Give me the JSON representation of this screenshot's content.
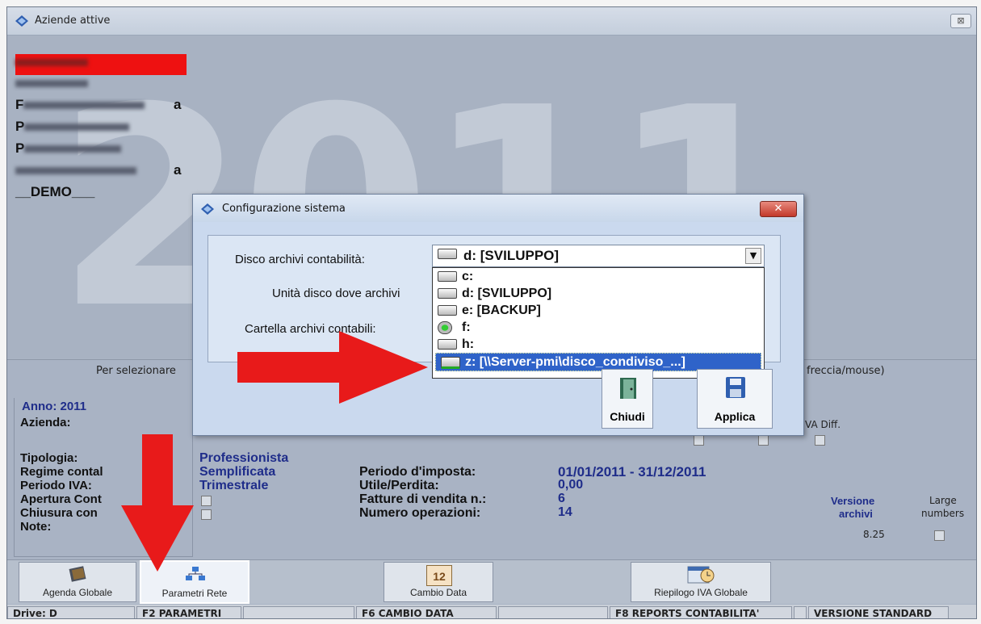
{
  "window": {
    "title": "Aziende attive",
    "close_glyph": "⊠"
  },
  "background_year": "2011",
  "companies": {
    "items": [
      {
        "label": "",
        "suffix": "",
        "blur_w": 90,
        "selected": true
      },
      {
        "label": "",
        "suffix": "",
        "blur_w": 90,
        "selected": false
      },
      {
        "label": "F",
        "suffix": "a",
        "blur_w": 150,
        "selected": false
      },
      {
        "label": "P",
        "suffix": "",
        "blur_w": 130,
        "selected": false
      },
      {
        "label": "P",
        "suffix": "",
        "blur_w": 120,
        "selected": false
      },
      {
        "label": "",
        "suffix": "a",
        "blur_w": 150,
        "selected": false
      },
      {
        "label": "__DEMO___",
        "suffix": "",
        "blur_w": 0,
        "selected": false
      }
    ]
  },
  "hint": {
    "left": "Per selezionare",
    "right": "freccia/mouse)"
  },
  "info": {
    "year_label": "Anno: 2011",
    "azienda_label": "Azienda:",
    "tipologia_label": "Tipologia:",
    "regime_label": "Regime contal",
    "periodo_iva_label": "Periodo IVA:",
    "apertura_label": "Apertura Cont",
    "chiusura_label": "Chiusura con",
    "note_label": "Note:",
    "tipologia_value": "Professionista",
    "regime_value": "Semplificata",
    "periodo_iva_value": "Trimestrale",
    "periodo_imposta_label": "Periodo d'imposta:",
    "utile_label": "Utile/Perdita:",
    "fatture_label": "Fatture di vendita n.:",
    "operazioni_label": "Numero operazioni:",
    "periodo_imposta_value": "01/01/2011 - 31/12/2011",
    "utile_value": "0,00",
    "fatture_value": "6",
    "operazioni_value": "14",
    "iva_diff_label": "VA Diff.",
    "versione_label_1": "Versione",
    "versione_label_2": "archivi",
    "versione_value": "8.25",
    "large_label_1": "Large",
    "large_label_2": "numbers"
  },
  "toolbar": {
    "agenda": "Agenda Globale",
    "parametri": "Parametri Rete",
    "cambio": "Cambio Data",
    "calendar_day": "12",
    "riepilogo": "Riepilogo IVA Globale"
  },
  "statusbar": {
    "drive": "Drive: D",
    "f2": "F2 PARAMETRI",
    "f6": "F6 CAMBIO DATA",
    "f8": "F8 REPORTS CONTABILITA'",
    "versione": "VERSIONE STANDARD"
  },
  "dialog": {
    "title": "Configurazione sistema",
    "close_glyph": "✕",
    "disco_label": "Disco archivi contabilità:",
    "unita_label": "Unità disco dove archivi",
    "cartella_label": "Cartella archivi contabili:",
    "combo_value": "d: [SVILUPPO]",
    "combo_arrow": "▼",
    "options": [
      {
        "label": "c:",
        "icon": "hard-drive-icon"
      },
      {
        "label": "d: [SVILUPPO]",
        "icon": "hard-drive-icon"
      },
      {
        "label": "e: [BACKUP]",
        "icon": "hard-drive-icon"
      },
      {
        "label": "f:",
        "icon": "cd-drive-icon"
      },
      {
        "label": "h:",
        "icon": "hard-drive-icon"
      },
      {
        "label": "z: [\\\\Server-pmi\\disco_condiviso_...]",
        "icon": "network-drive-icon"
      }
    ],
    "chiudi": "Chiudi",
    "applica": "Applica"
  },
  "colors": {
    "accent_red": "#e81a1a",
    "selection_blue": "#2f63c9",
    "value_blue": "#1f2d8a"
  }
}
